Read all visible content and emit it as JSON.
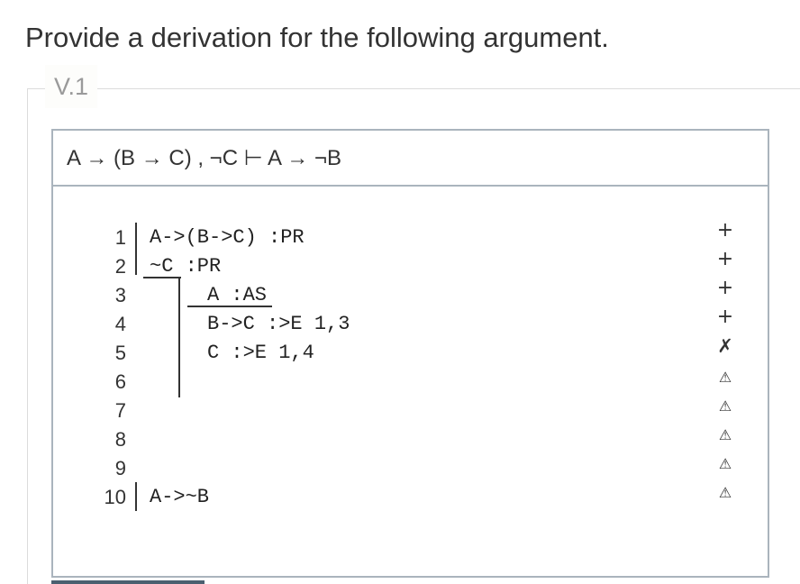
{
  "instruction": "Provide a derivation for the following argument.",
  "problem": {
    "legend": "V.1",
    "argument": "A → (B → C) , ¬C ⊢ A → ¬B"
  },
  "proof": {
    "lines": [
      {
        "num": "1",
        "text": "A->(B->C) :PR",
        "status": "+"
      },
      {
        "num": "2",
        "text": "~C :PR",
        "status": "+"
      },
      {
        "num": "3",
        "text": "A :AS",
        "status": "+"
      },
      {
        "num": "4",
        "text": "B->C :>E 1,3",
        "status": "+"
      },
      {
        "num": "5",
        "text": "C :>E 1,4",
        "status": "✗"
      },
      {
        "num": "6",
        "text": "",
        "status": "⚠"
      },
      {
        "num": "7",
        "text": "",
        "status": "⚠"
      },
      {
        "num": "8",
        "text": "",
        "status": "⚠"
      },
      {
        "num": "9",
        "text": "",
        "status": "⚠"
      },
      {
        "num": "10",
        "text": "A->~B",
        "status": "⚠"
      }
    ]
  }
}
